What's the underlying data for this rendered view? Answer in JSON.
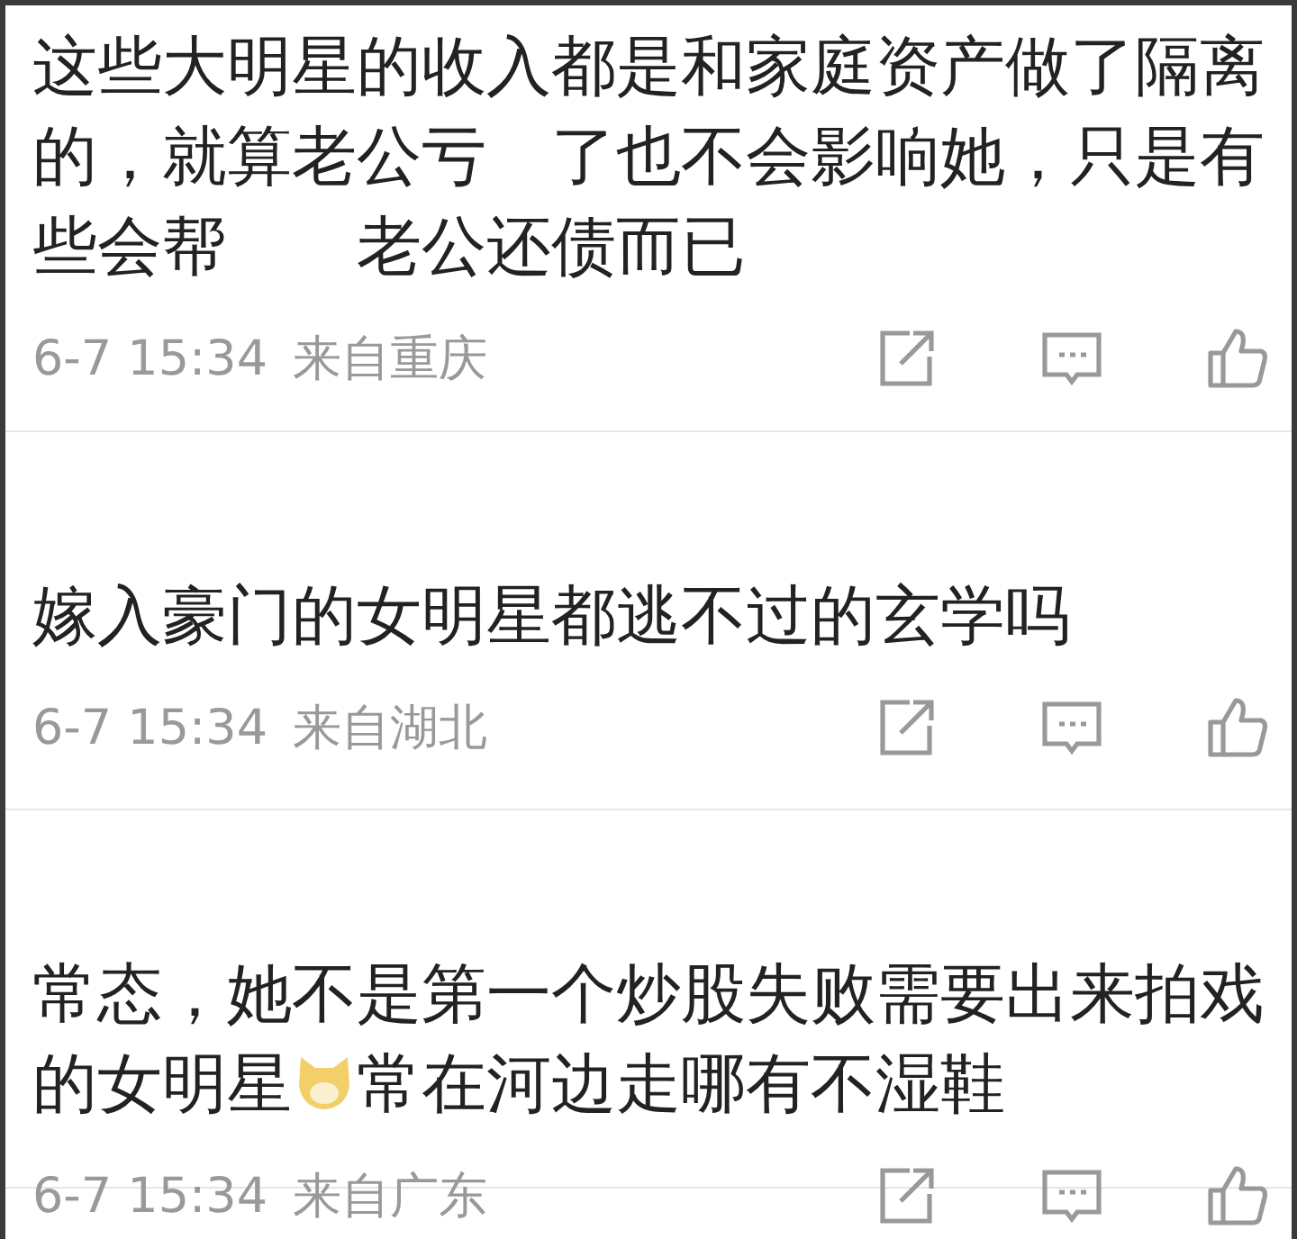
{
  "comments": [
    {
      "content": [
        {
          "kind": "text",
          "text": "这些大明星的收入都是和家庭资产做了隔离的，就算老公亏　了也不会影响她，只是有些会帮　　老公还债而已"
        }
      ],
      "date": "6-7 15:34",
      "location": "来自重庆"
    },
    {
      "content": [
        {
          "kind": "text",
          "text": "嫁入豪门的女明星都逃不过的玄学吗"
        }
      ],
      "date": "6-7 15:34",
      "location": "来自湖北"
    },
    {
      "content": [
        {
          "kind": "text",
          "text": "常态，她不是第一个炒股失败需要出来拍戏"
        },
        {
          "kind": "text",
          "text": "的女明星"
        },
        {
          "kind": "emoji"
        },
        {
          "kind": "text",
          "text": "常在河边走哪有不湿鞋"
        }
      ],
      "date": "6-7 15:34",
      "location": "来自广东"
    }
  ]
}
